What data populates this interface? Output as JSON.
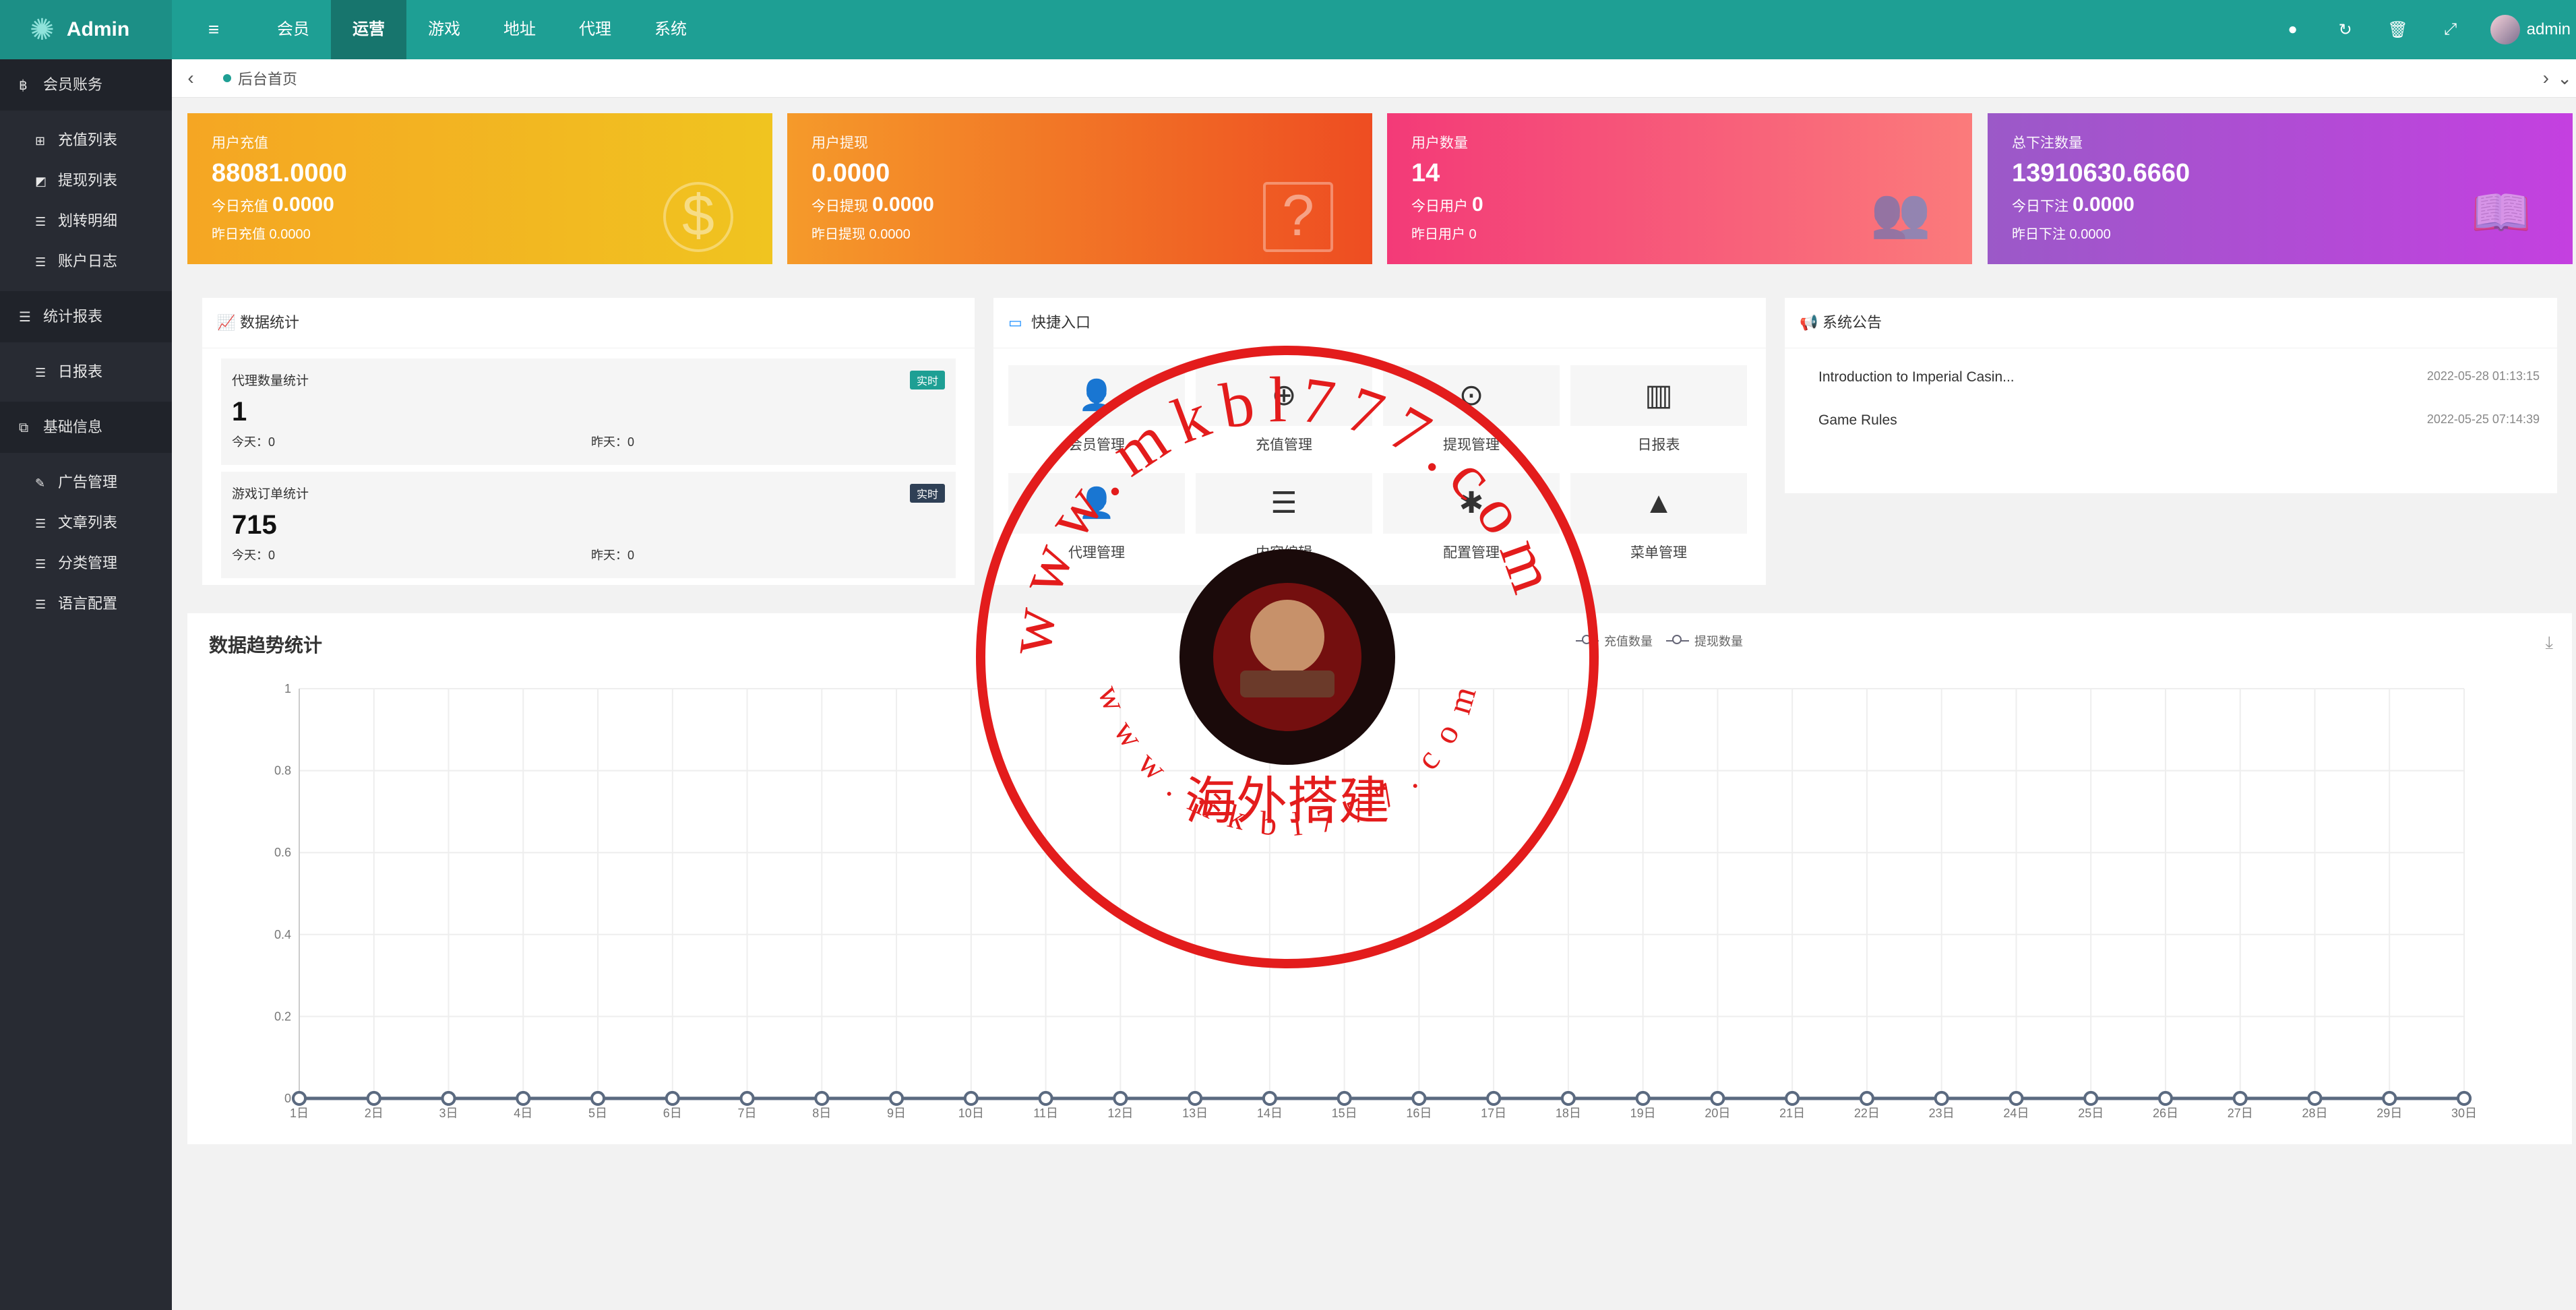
{
  "header": {
    "brand": "Admin",
    "menu_toggle_icon": "≡",
    "nav": [
      {
        "label": "会员",
        "active": false
      },
      {
        "label": "运营",
        "active": true
      },
      {
        "label": "游戏",
        "active": false
      },
      {
        "label": "地址",
        "active": false
      },
      {
        "label": "代理",
        "active": false
      },
      {
        "label": "系统",
        "active": false
      }
    ],
    "user": "admin"
  },
  "sidebar": {
    "groups": [
      {
        "label": "会员账务",
        "icon": "฿",
        "items": [
          {
            "label": "充值列表",
            "icon": "⊞"
          },
          {
            "label": "提现列表",
            "icon": "◩"
          },
          {
            "label": "划转明细",
            "icon": "☰"
          },
          {
            "label": "账户日志",
            "icon": "☰"
          }
        ]
      },
      {
        "label": "统计报表",
        "icon": "☰",
        "items": [
          {
            "label": "日报表",
            "icon": "☰"
          }
        ]
      },
      {
        "label": "基础信息",
        "icon": "⧉",
        "items": [
          {
            "label": "广告管理",
            "icon": "✎"
          },
          {
            "label": "文章列表",
            "icon": "☰"
          },
          {
            "label": "分类管理",
            "icon": "☰"
          },
          {
            "label": "语言配置",
            "icon": "☰"
          }
        ]
      }
    ]
  },
  "tabs": {
    "prev": "‹",
    "next": "›",
    "more": "⌄",
    "home": "后台首页"
  },
  "cards": [
    {
      "title": "用户充值",
      "value": "88081.0000",
      "today_label": "今日充值",
      "today_value": "0.0000",
      "yesterday": "昨日充值 0.0000",
      "icon": "$"
    },
    {
      "title": "用户提现",
      "value": "0.0000",
      "today_label": "今日提现",
      "today_value": "0.0000",
      "yesterday": "昨日提现 0.0000",
      "icon": "?"
    },
    {
      "title": "用户数量",
      "value": "14",
      "today_label": "今日用户",
      "today_value": "0",
      "yesterday": "昨日用户 0",
      "icon": "👥"
    },
    {
      "title": "总下注数量",
      "value": "13910630.6660",
      "today_label": "今日下注",
      "today_value": "0.0000",
      "yesterday": "昨日下注 0.0000",
      "icon": "📖"
    }
  ],
  "stats_panel": {
    "title": "数据统计",
    "boxes": [
      {
        "label": "代理数量统计",
        "badge": "实时",
        "badge_color": "#1e9f94",
        "value": "1",
        "today": "今天：0",
        "yesterday": "昨天：0"
      },
      {
        "label": "游戏订单统计",
        "badge": "实时",
        "badge_color": "#2f4056",
        "value": "715",
        "today": "今天：0",
        "yesterday": "昨天：0"
      }
    ]
  },
  "quick_panel": {
    "title": "快捷入口",
    "items": [
      {
        "label": "会员管理",
        "icon": "👤"
      },
      {
        "label": "充值管理",
        "icon": "⊕"
      },
      {
        "label": "提现管理",
        "icon": "⊙"
      },
      {
        "label": "日报表",
        "icon": "▥"
      },
      {
        "label": "代理管理",
        "icon": "👤"
      },
      {
        "label": "内容编辑",
        "icon": "☰"
      },
      {
        "label": "配置管理",
        "icon": "✱"
      },
      {
        "label": "菜单管理",
        "icon": "▲"
      }
    ]
  },
  "notice_panel": {
    "title": "系统公告",
    "items": [
      {
        "title": "Introduction to Imperial Casin...",
        "date": "2022-05-28 01:13:15"
      },
      {
        "title": "Game Rules",
        "date": "2022-05-25 07:14:39"
      }
    ]
  },
  "chart_title": "数据趋势统计",
  "chart_data": {
    "type": "line",
    "categories": [
      "1日",
      "2日",
      "3日",
      "4日",
      "5日",
      "6日",
      "7日",
      "8日",
      "9日",
      "10日",
      "11日",
      "12日",
      "13日",
      "14日",
      "15日",
      "16日",
      "17日",
      "18日",
      "19日",
      "20日",
      "21日",
      "22日",
      "23日",
      "24日",
      "25日",
      "26日",
      "27日",
      "28日",
      "29日",
      "30日"
    ],
    "series": [
      {
        "name": "充值数量",
        "values": [
          0,
          0,
          0,
          0,
          0,
          0,
          0,
          0,
          0,
          0,
          0,
          0,
          0,
          0,
          0,
          0,
          0,
          0,
          0,
          0,
          0,
          0,
          0,
          0,
          0,
          0,
          0,
          0,
          0,
          0
        ]
      },
      {
        "name": "提现数量",
        "values": [
          0,
          0,
          0,
          0,
          0,
          0,
          0,
          0,
          0,
          0,
          0,
          0,
          0,
          0,
          0,
          0,
          0,
          0,
          0,
          0,
          0,
          0,
          0,
          0,
          0,
          0,
          0,
          0,
          0,
          0
        ]
      }
    ],
    "yticks": [
      "0",
      "0.2",
      "0.4",
      "0.6",
      "0.8",
      "1"
    ],
    "ylim": [
      0,
      1
    ],
    "grid": true,
    "series_color": "#5b6a80"
  },
  "stamp": {
    "outer_text": "www.mkbl777.com",
    "inner_text": "海外搭建",
    "bottom_text": "www.mkbl777.com",
    "color": "#e31c1c"
  }
}
